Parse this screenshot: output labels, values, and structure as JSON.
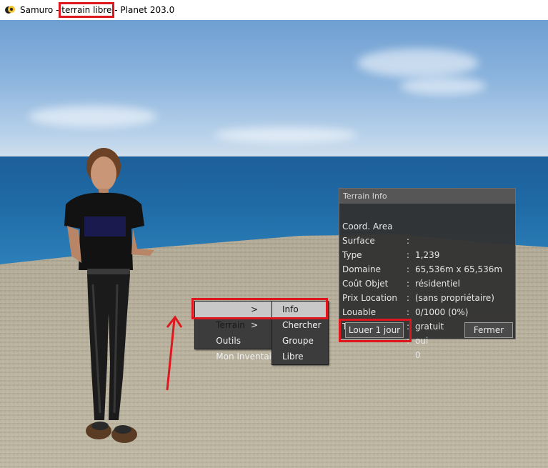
{
  "window": {
    "title_parts": [
      "Samuro",
      "terrain libre",
      "Planet 203.0"
    ],
    "title_separator": " - ",
    "app_icon": "viewer-app-icon"
  },
  "context_menu": {
    "items": [
      {
        "label": "Terrain",
        "arrow": ">"
      },
      {
        "label": "Outils",
        "arrow": ">"
      },
      {
        "label": "Mon Inventaire",
        "arrow": ""
      }
    ],
    "submenu": [
      "Info",
      "Chercher",
      "Groupe",
      "Libre"
    ]
  },
  "terrain_info": {
    "title": "Terrain Info",
    "rows": [
      {
        "label": "Coord. Area",
        "value": "1,239"
      },
      {
        "label": "Surface",
        "value": "65,536m x 65,536m"
      },
      {
        "label": "Type",
        "value": "résidentiel"
      },
      {
        "label": "Domaine",
        "value": "(sans propriétaire)"
      },
      {
        "label": "Coût Objet",
        "value": "0/1000 (0%)"
      },
      {
        "label": "Prix Location",
        "value": "gratuit"
      },
      {
        "label": "Louable",
        "value": "oui"
      },
      {
        "label": "Trafic",
        "value": "0"
      }
    ],
    "separator": ":",
    "rent_button": "Louer 1 jour",
    "close_button": "Fermer"
  },
  "colors": {
    "highlight": "#e0161e",
    "panel_bg": "#323232",
    "menu_bg": "#3c3c3c",
    "menu_active": "#c8c8c8"
  }
}
